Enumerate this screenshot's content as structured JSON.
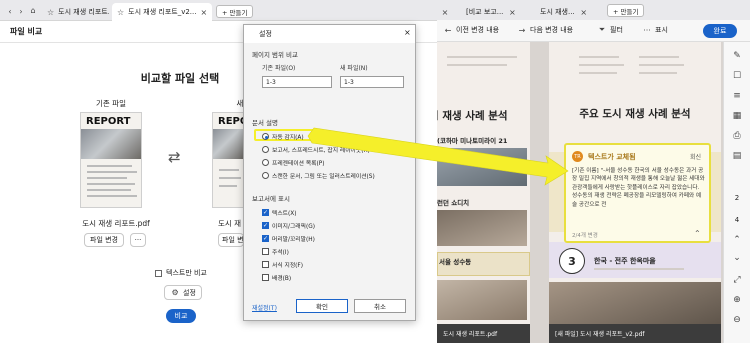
{
  "left_window": {
    "tabs": [
      {
        "label": "도시 재생 리포트..."
      },
      {
        "label": "도시 재생 리포트_v2..."
      }
    ],
    "new_tab_label": "+ 만들기",
    "title": "파일 비교",
    "heading": "비교할 파일 선택",
    "original": {
      "label": "기존 파일",
      "thumb_text": "REPORT",
      "filename": "도시 재생 리포트.pdf",
      "change_label": "파일 변경",
      "more_label": "···"
    },
    "new": {
      "label": "새",
      "thumb_text": "REPORT",
      "filename": "도시 재",
      "change_label": "파일 변경"
    },
    "text_only_label": "텍스트만 비교",
    "settings_label": "설정",
    "compare_label": "비교"
  },
  "dialog": {
    "title": "설정",
    "page_range_section": "페이지 범위 비교",
    "orig_file_label": "기존 파일(O)",
    "orig_file_value": "1-3",
    "new_file_label": "새 파일(N)",
    "new_file_value": "1-3",
    "doc_type_section": "문서 설명",
    "doc_types": [
      {
        "label": "자동 감지(A)",
        "selected": true
      },
      {
        "label": "보고서, 스프레드시트, 잡지 레이아웃(R)",
        "selected": false
      },
      {
        "label": "프레젠테이션 목록(P)",
        "selected": false
      },
      {
        "label": "스캔한 문서, 그림 또는 일러스트레이션(S)",
        "selected": false
      }
    ],
    "report_section": "보고서에 표시",
    "report_items": [
      {
        "label": "텍스트(X)",
        "checked": true
      },
      {
        "label": "이미지/그래픽(G)",
        "checked": true
      },
      {
        "label": "머리말/꼬리말(H)",
        "checked": true
      },
      {
        "label": "주석(I)",
        "checked": false
      },
      {
        "label": "서식 지정(F)",
        "checked": false
      },
      {
        "label": "배경(B)",
        "checked": false
      }
    ],
    "reset_label": "재설정(T)",
    "ok_label": "확인",
    "cancel_label": "취소"
  },
  "right_window": {
    "tabs": [
      {
        "label": "[비교 보고..."
      },
      {
        "label": "도시 재생..."
      }
    ],
    "new_tab_label": "+ 만들기",
    "toolbar": {
      "prev_label": "이전 변경 내용",
      "next_label": "다음 변경 내용",
      "filter_label": "필터",
      "show_label": "표시",
      "done_label": "완료"
    },
    "left_page": {
      "title": "시 재생 사례 분석",
      "item1": "(코하마 미나토미라이 21",
      "item2": "런던 쇼디치",
      "item3": "서울 성수동",
      "footer": "도시 재생 리포트.pdf"
    },
    "right_page": {
      "title": "주요 도시 재생 사례 분석",
      "badge_number": "3",
      "badge_text": "한국 - 전주 한옥마을",
      "footer": "[새 파일] 도시 재생 리포트_v2.pdf"
    },
    "popup": {
      "title": "텍스트가 교체됨",
      "action_label": "회신",
      "body": "[기존 이름] \"-서울 성수동 한국의 서울 성수동은 과거 공장 밀집 지역에서 창의적 재생을 통해 오늘날 젊은 세대와 관광객들에게 사랑받는 핫플레이스로 자리 잡았습니다. 성수동의 재생 전략은 폐공장을 리모델링하여 카페와 예술 공간으로 전",
      "counter": "2/4개 변경"
    },
    "page_numbers": [
      "2",
      "4"
    ]
  },
  "colors": {
    "accent": "#1a63c9",
    "highlight": "#f5ef2a",
    "popup_bg": "#fdfbe8"
  }
}
